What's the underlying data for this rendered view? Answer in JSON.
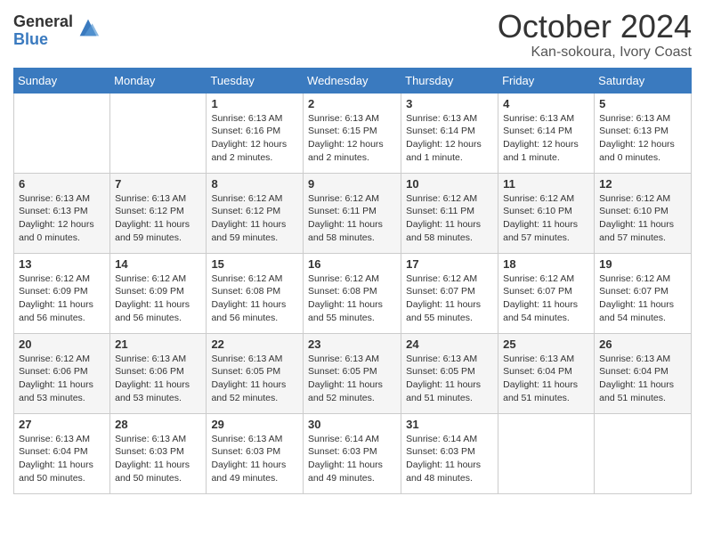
{
  "header": {
    "logo_general": "General",
    "logo_blue": "Blue",
    "month": "October 2024",
    "location": "Kan-sokoura, Ivory Coast"
  },
  "days_of_week": [
    "Sunday",
    "Monday",
    "Tuesday",
    "Wednesday",
    "Thursday",
    "Friday",
    "Saturday"
  ],
  "weeks": [
    [
      {
        "day": "",
        "info": ""
      },
      {
        "day": "",
        "info": ""
      },
      {
        "day": "1",
        "info": "Sunrise: 6:13 AM\nSunset: 6:16 PM\nDaylight: 12 hours and 2 minutes."
      },
      {
        "day": "2",
        "info": "Sunrise: 6:13 AM\nSunset: 6:15 PM\nDaylight: 12 hours and 2 minutes."
      },
      {
        "day": "3",
        "info": "Sunrise: 6:13 AM\nSunset: 6:14 PM\nDaylight: 12 hours and 1 minute."
      },
      {
        "day": "4",
        "info": "Sunrise: 6:13 AM\nSunset: 6:14 PM\nDaylight: 12 hours and 1 minute."
      },
      {
        "day": "5",
        "info": "Sunrise: 6:13 AM\nSunset: 6:13 PM\nDaylight: 12 hours and 0 minutes."
      }
    ],
    [
      {
        "day": "6",
        "info": "Sunrise: 6:13 AM\nSunset: 6:13 PM\nDaylight: 12 hours and 0 minutes."
      },
      {
        "day": "7",
        "info": "Sunrise: 6:13 AM\nSunset: 6:12 PM\nDaylight: 11 hours and 59 minutes."
      },
      {
        "day": "8",
        "info": "Sunrise: 6:12 AM\nSunset: 6:12 PM\nDaylight: 11 hours and 59 minutes."
      },
      {
        "day": "9",
        "info": "Sunrise: 6:12 AM\nSunset: 6:11 PM\nDaylight: 11 hours and 58 minutes."
      },
      {
        "day": "10",
        "info": "Sunrise: 6:12 AM\nSunset: 6:11 PM\nDaylight: 11 hours and 58 minutes."
      },
      {
        "day": "11",
        "info": "Sunrise: 6:12 AM\nSunset: 6:10 PM\nDaylight: 11 hours and 57 minutes."
      },
      {
        "day": "12",
        "info": "Sunrise: 6:12 AM\nSunset: 6:10 PM\nDaylight: 11 hours and 57 minutes."
      }
    ],
    [
      {
        "day": "13",
        "info": "Sunrise: 6:12 AM\nSunset: 6:09 PM\nDaylight: 11 hours and 56 minutes."
      },
      {
        "day": "14",
        "info": "Sunrise: 6:12 AM\nSunset: 6:09 PM\nDaylight: 11 hours and 56 minutes."
      },
      {
        "day": "15",
        "info": "Sunrise: 6:12 AM\nSunset: 6:08 PM\nDaylight: 11 hours and 56 minutes."
      },
      {
        "day": "16",
        "info": "Sunrise: 6:12 AM\nSunset: 6:08 PM\nDaylight: 11 hours and 55 minutes."
      },
      {
        "day": "17",
        "info": "Sunrise: 6:12 AM\nSunset: 6:07 PM\nDaylight: 11 hours and 55 minutes."
      },
      {
        "day": "18",
        "info": "Sunrise: 6:12 AM\nSunset: 6:07 PM\nDaylight: 11 hours and 54 minutes."
      },
      {
        "day": "19",
        "info": "Sunrise: 6:12 AM\nSunset: 6:07 PM\nDaylight: 11 hours and 54 minutes."
      }
    ],
    [
      {
        "day": "20",
        "info": "Sunrise: 6:12 AM\nSunset: 6:06 PM\nDaylight: 11 hours and 53 minutes."
      },
      {
        "day": "21",
        "info": "Sunrise: 6:13 AM\nSunset: 6:06 PM\nDaylight: 11 hours and 53 minutes."
      },
      {
        "day": "22",
        "info": "Sunrise: 6:13 AM\nSunset: 6:05 PM\nDaylight: 11 hours and 52 minutes."
      },
      {
        "day": "23",
        "info": "Sunrise: 6:13 AM\nSunset: 6:05 PM\nDaylight: 11 hours and 52 minutes."
      },
      {
        "day": "24",
        "info": "Sunrise: 6:13 AM\nSunset: 6:05 PM\nDaylight: 11 hours and 51 minutes."
      },
      {
        "day": "25",
        "info": "Sunrise: 6:13 AM\nSunset: 6:04 PM\nDaylight: 11 hours and 51 minutes."
      },
      {
        "day": "26",
        "info": "Sunrise: 6:13 AM\nSunset: 6:04 PM\nDaylight: 11 hours and 51 minutes."
      }
    ],
    [
      {
        "day": "27",
        "info": "Sunrise: 6:13 AM\nSunset: 6:04 PM\nDaylight: 11 hours and 50 minutes."
      },
      {
        "day": "28",
        "info": "Sunrise: 6:13 AM\nSunset: 6:03 PM\nDaylight: 11 hours and 50 minutes."
      },
      {
        "day": "29",
        "info": "Sunrise: 6:13 AM\nSunset: 6:03 PM\nDaylight: 11 hours and 49 minutes."
      },
      {
        "day": "30",
        "info": "Sunrise: 6:14 AM\nSunset: 6:03 PM\nDaylight: 11 hours and 49 minutes."
      },
      {
        "day": "31",
        "info": "Sunrise: 6:14 AM\nSunset: 6:03 PM\nDaylight: 11 hours and 48 minutes."
      },
      {
        "day": "",
        "info": ""
      },
      {
        "day": "",
        "info": ""
      }
    ]
  ]
}
